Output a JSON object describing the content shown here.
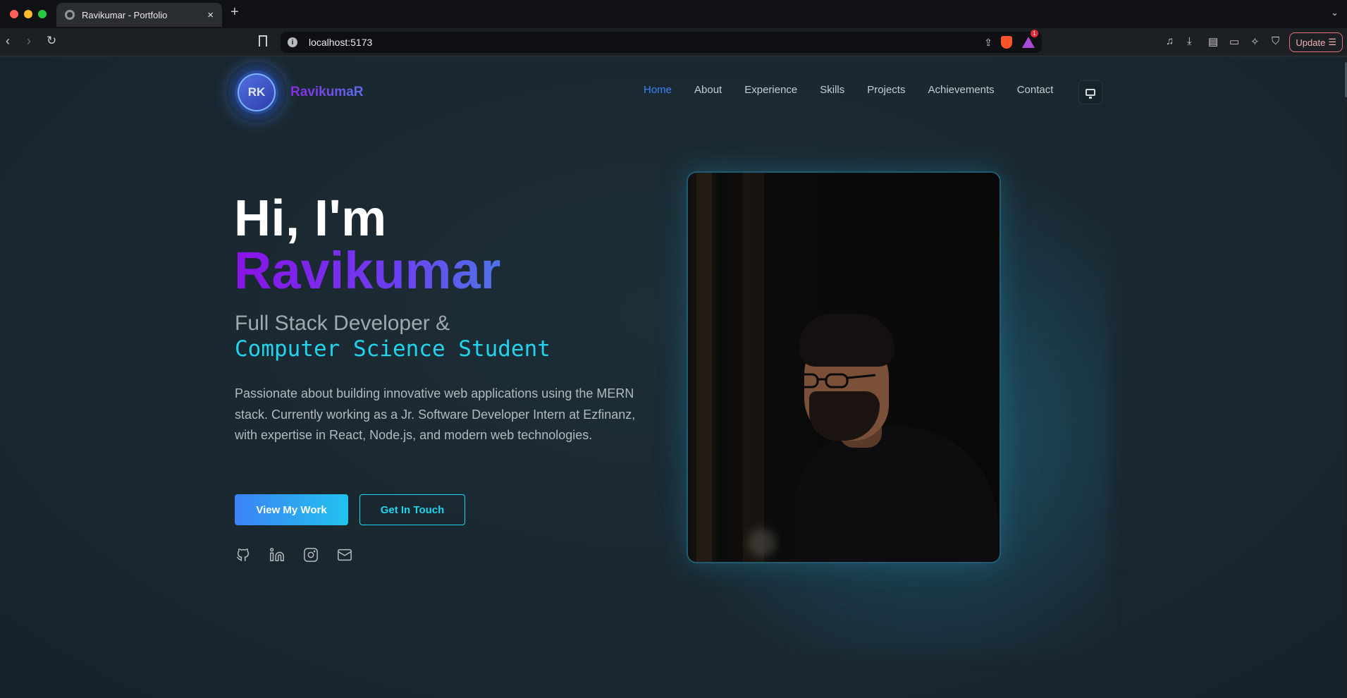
{
  "browser": {
    "tab_title": "Ravikumar - Portfolio",
    "tab_close": "×",
    "new_tab": "+",
    "url": "localhost:5173",
    "rewards_count": "1",
    "update_label": "Update"
  },
  "site": {
    "logo_initials": "RK",
    "logo_name": "RavikumaR",
    "nav": [
      {
        "label": "Home",
        "active": true
      },
      {
        "label": "About"
      },
      {
        "label": "Experience"
      },
      {
        "label": "Skills"
      },
      {
        "label": "Projects"
      },
      {
        "label": "Achievements"
      },
      {
        "label": "Contact"
      }
    ]
  },
  "hero": {
    "greeting": "Hi, I'm",
    "name": "Ravikumar",
    "role_line1": "Full Stack Developer &",
    "role_line2": "Computer Science Student",
    "description": "Passionate about building innovative web applications using the MERN stack. Currently working as a Jr. Software Developer Intern at Ezfinanz, with expertise in React, Node.js, and modern web technologies.",
    "primary_button": "View My Work",
    "secondary_button": "Get In Touch",
    "socials": [
      "github-icon",
      "linkedin-icon",
      "instagram-icon",
      "mail-icon"
    ]
  },
  "colors": {
    "accent_blue": "#3b82f6",
    "accent_cyan": "#22d3ee",
    "name_gradient_start": "#8a12e6",
    "name_gradient_end": "#4f74e8",
    "background": "#1b2a33"
  }
}
